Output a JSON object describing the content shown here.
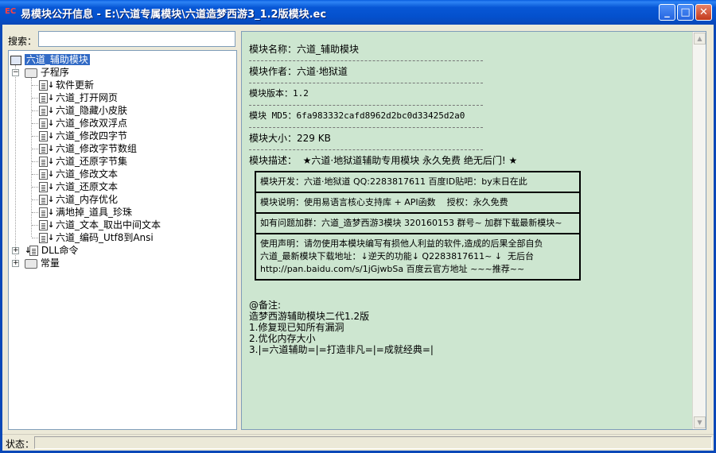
{
  "window": {
    "icon": "EC",
    "title": "易模块公开信息 - E:\\六道专属模块\\六道造梦西游3_1.2版模块.ec",
    "buttons": {
      "minimize": "_",
      "maximize": "□",
      "close": "✕"
    }
  },
  "search": {
    "label": "搜索：",
    "value": "",
    "placeholder": ""
  },
  "tree": {
    "root": "六道_辅助模块",
    "subprogram_group": "子程序",
    "subprograms": [
      "软件更新",
      "六道_打开网页",
      "六道_隐藏小皮肤",
      "六道_修改双浮点",
      "六道_修改四字节",
      "六道_修改字节数组",
      "六道_还原字节集",
      "六道_修改文本",
      "六道_还原文本",
      "六道_内存优化",
      "满地掉_道具_珍珠",
      "六道_文本_取出中间文本",
      "六道_编码_Utf8到Ansi"
    ],
    "dll_group": "DLL命令",
    "const_group": "常量"
  },
  "content": {
    "name": "模块名称：六道_辅助模块",
    "author": "模块作者：六道·地狱道",
    "version": "模块版本：1.2",
    "md5": "模块 MD5：6fa983332cafd8962d2bc0d33425d2a0",
    "size": "模块大小：229 KB",
    "desc": "模块描述：  ★六道·地狱道辅助专用模块 永久免费 绝无后门! ★",
    "box": [
      "模块开发：六道·地狱道 QQ:2283817611 百度ID贴吧：by末日在此",
      "模块说明：使用易语言核心支持库 + API函数    授权：永久免费",
      "如有问题加群：六道_造梦西游3模块 320160153 群号~ 加群下载最新模块~",
      "使用声明：请勿使用本模块编写有损他人利益的软件,造成的后果全部自负\n六道_最新模块下载地址：↓逆天的功能↓ Q2283817611~ ↓  无后台\nhttp://pan.baidu.com/s/1jGjwbSa 百度云官方地址 ~~~推荐~~"
    ],
    "notes": [
      "@备注:",
      "造梦西游辅助模块二代1.2版",
      "1.修复现已知所有漏洞",
      "2.优化内存大小",
      "3.|=六道辅助=|=打造非凡=|=成就经典=|"
    ]
  },
  "status": {
    "label": "状态：",
    "value": ""
  },
  "colors": {
    "title_bar": "#0a58d8",
    "content_bg": "#cde6d0",
    "selection": "#316ac5"
  }
}
